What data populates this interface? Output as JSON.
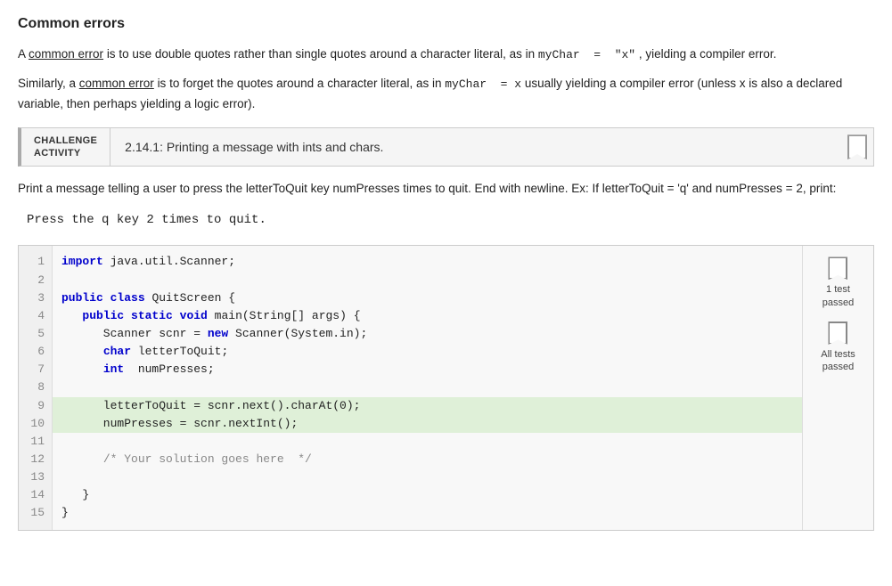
{
  "page": {
    "section_title": "Common errors",
    "error1": {
      "text_before": "A",
      "link1": "common error",
      "text_middle1": "is to use double quotes rather than single quotes around a character literal, as in",
      "code1": "myChar  =  \"x\"",
      "text_end": ", yielding a compiler error."
    },
    "error2": {
      "text_before": "Similarly, a",
      "link2": "common error",
      "text_middle": "is to forget the quotes around the character literal, as in",
      "code2": "myChar  =  x",
      "text_end": "usually yielding a compiler error (unless x is also a declared variable, then perhaps yielding a logic error)."
    },
    "challenge": {
      "label_line1": "CHALLENGE",
      "label_line2": "ACTIVITY",
      "title": "2.14.1: Printing a message with ints and chars."
    },
    "description": "Print a message telling a user to press the letterToQuit key numPresses times to quit. End with newline. Ex: If letterToQuit = 'q' and numPresses = 2, print:",
    "code_example": "Press the q key 2 times to quit.",
    "code_lines": [
      {
        "num": "1",
        "text": "import java.util.Scanner;"
      },
      {
        "num": "2",
        "text": ""
      },
      {
        "num": "3",
        "text": "public class QuitScreen {"
      },
      {
        "num": "4",
        "text": "   public static void main(String[] args) {"
      },
      {
        "num": "5",
        "text": "      Scanner scnr = new Scanner(System.in);"
      },
      {
        "num": "6",
        "text": "      char letterToQuit;"
      },
      {
        "num": "7",
        "text": "      int  numPresses;"
      },
      {
        "num": "8",
        "text": ""
      },
      {
        "num": "9",
        "text": "      letterToQuit = scnr.next().charAt(0);",
        "highlight": true
      },
      {
        "num": "10",
        "text": "      numPresses = scnr.nextInt();",
        "highlight": true
      },
      {
        "num": "11",
        "text": ""
      },
      {
        "num": "12",
        "text": "      /* Your solution goes here  */"
      },
      {
        "num": "13",
        "text": ""
      },
      {
        "num": "14",
        "text": "   }"
      },
      {
        "num": "15",
        "text": "}"
      }
    ],
    "status": {
      "test1_label": "1 test\npassed",
      "test2_label": "All tests\npassed"
    }
  }
}
